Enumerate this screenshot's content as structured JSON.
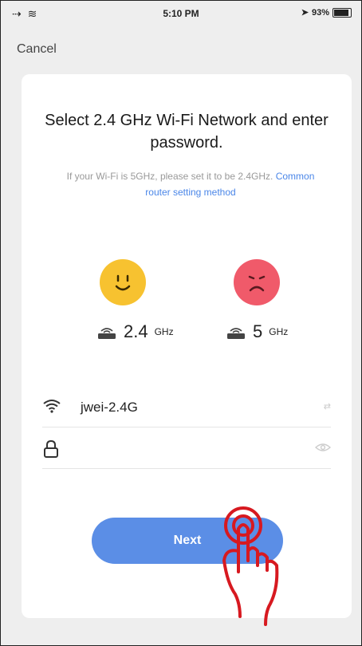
{
  "statusbar": {
    "time": "5:10 PM",
    "battery": "93%"
  },
  "header": {
    "cancel_label": "Cancel"
  },
  "card": {
    "title": "Select 2.4 GHz Wi-Fi Network and enter password.",
    "hint_text": "If your Wi-Fi is 5GHz, please set it to be 2.4GHz.",
    "hint_link": "Common router setting method"
  },
  "bands": [
    {
      "value": "2.4",
      "unit": "GHz",
      "status": "supported"
    },
    {
      "value": "5",
      "unit": "GHz",
      "status": "not supported"
    }
  ],
  "form": {
    "ssid_value": "jwei-2.4G",
    "password_value": "",
    "password_placeholder": ""
  },
  "actions": {
    "next_label": "Next"
  },
  "colors": {
    "accent": "#5b8ee6",
    "happy": "#f7c230",
    "sad": "#f05a6a"
  }
}
